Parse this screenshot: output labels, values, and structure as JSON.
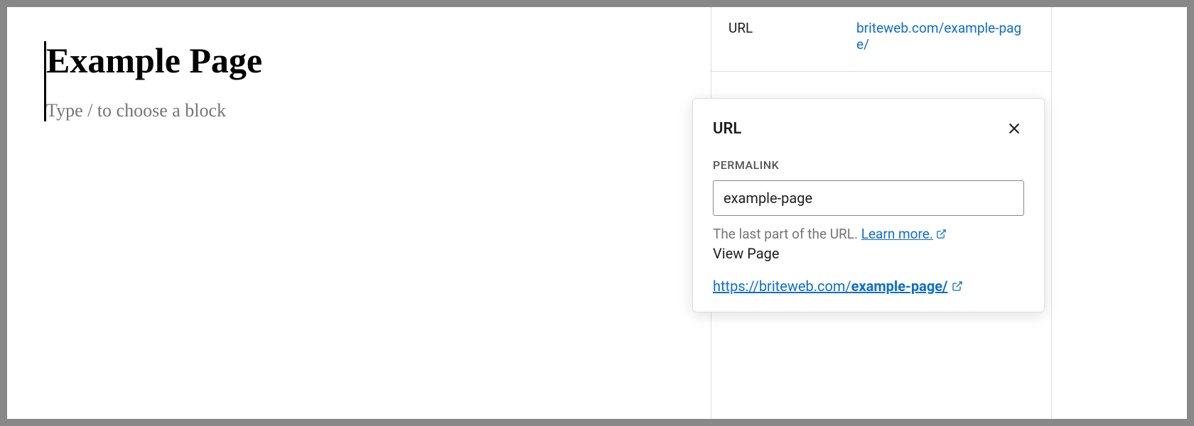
{
  "editor": {
    "page_title": "Example Page",
    "block_placeholder": "Type / to choose a block"
  },
  "sidebar": {
    "url_row": {
      "label": "URL",
      "value": "briteweb.com/example-page/"
    }
  },
  "popover": {
    "title": "URL",
    "permalink_label": "PERMALINK",
    "permalink_value": "example-page",
    "help_text": "The last part of the URL. ",
    "learn_more_text": "Learn more.",
    "view_page_label": "View Page",
    "full_url_prefix": "https://briteweb.com/",
    "full_url_slug": "example-page/"
  }
}
